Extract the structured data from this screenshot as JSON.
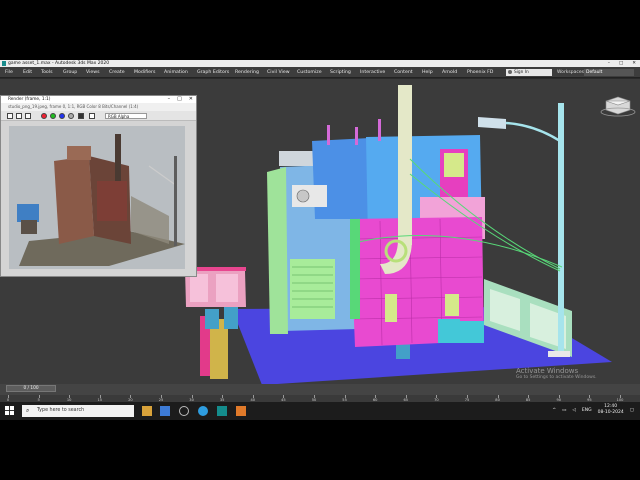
{
  "window": {
    "title": "game asset_1.max - Autodesk 3ds Max 2020"
  },
  "menu": {
    "items": [
      "File",
      "Edit",
      "Tools",
      "Group",
      "Views",
      "Create",
      "Modifiers",
      "Animation",
      "Graph Editors",
      "Rendering",
      "Civil View",
      "Customize",
      "Scripting",
      "Interactive",
      "Content",
      "Help",
      "Arnold",
      "Phoenix FD"
    ],
    "signin_label": "Sign In",
    "workspaces_label": "Workspaces:",
    "workspace_value": "Default"
  },
  "frame_buffer": {
    "title": "Render (frame, 1:1)",
    "info": "studio_png_19.jpeg, frame 0, 1:1, RGB Color 8 Bits/Channel (1:4)",
    "channel_value": "RGB Alpha"
  },
  "timeline": {
    "slider_label": "0 / 100",
    "ticks": [
      "0",
      "5",
      "10",
      "15",
      "20",
      "25",
      "30",
      "35",
      "40",
      "45",
      "50",
      "55",
      "60",
      "65",
      "70",
      "75",
      "80",
      "85",
      "90",
      "95",
      "100"
    ]
  },
  "watermark": {
    "line1": "Activate Windows",
    "line2": "Go to Settings to activate Windows."
  },
  "taskbar": {
    "search_placeholder": "Type here to search",
    "language": "ENG",
    "time": "12:40",
    "date": "08-10-2024"
  },
  "colors": {
    "accent": "#00a3ff",
    "menubar": "#3d3d3d",
    "viewport": "#3b3b3b",
    "ground": "#4b45e0"
  }
}
